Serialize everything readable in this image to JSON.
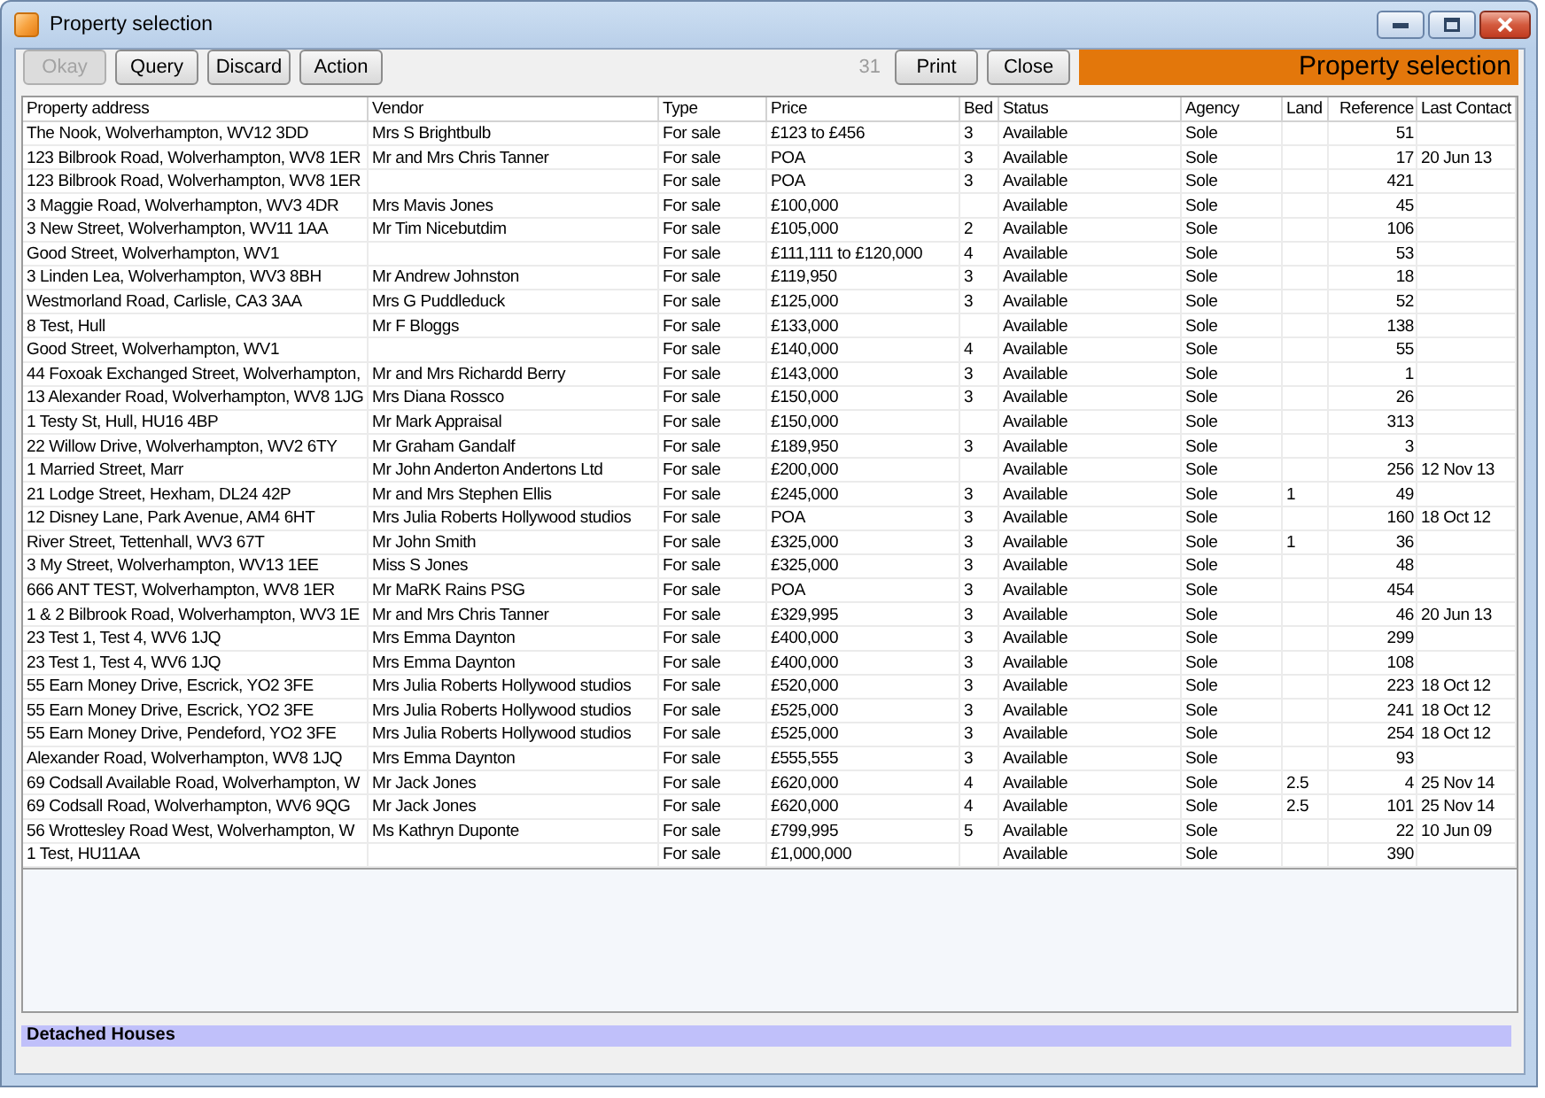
{
  "window": {
    "title": "Property selection"
  },
  "toolbar": {
    "buttons": [
      {
        "label": "Okay",
        "disabled": true
      },
      {
        "label": "Query",
        "disabled": false
      },
      {
        "label": "Discard",
        "disabled": false
      },
      {
        "label": "Action",
        "disabled": false
      }
    ],
    "record_count": "31",
    "right_buttons": [
      {
        "label": "Print",
        "disabled": false
      },
      {
        "label": "Close",
        "disabled": false
      }
    ],
    "banner": "Property selection"
  },
  "table": {
    "columns": [
      {
        "label": "Property address",
        "kind": "text"
      },
      {
        "label": "Vendor",
        "kind": "text"
      },
      {
        "label": "Type",
        "kind": "text"
      },
      {
        "label": "Price",
        "kind": "text"
      },
      {
        "label": "Bed",
        "kind": "text"
      },
      {
        "label": "Status",
        "kind": "text"
      },
      {
        "label": "Agency",
        "kind": "text"
      },
      {
        "label": "Land",
        "kind": "text"
      },
      {
        "label": "Reference",
        "kind": "number"
      },
      {
        "label": "Last Contact",
        "kind": "text"
      }
    ],
    "rows": [
      [
        "The Nook, Wolverhampton, WV12 3DD",
        "Mrs S Brightbulb",
        "For sale",
        "£123 to £456",
        "3",
        "Available",
        "Sole",
        null,
        "51",
        null
      ],
      [
        "123 Bilbrook Road, Wolverhampton, WV8 1ER",
        "Mr and Mrs Chris Tanner",
        "For sale",
        "POA",
        "3",
        "Available",
        "Sole",
        null,
        "17",
        "20 Jun 13"
      ],
      [
        "123 Bilbrook Road, Wolverhampton, WV8 1ER",
        null,
        "For sale",
        "POA",
        "3",
        "Available",
        "Sole",
        null,
        "421",
        null
      ],
      [
        "3 Maggie Road, Wolverhampton, WV3 4DR",
        "Mrs Mavis Jones",
        "For sale",
        "£100,000",
        null,
        "Available",
        "Sole",
        null,
        "45",
        null
      ],
      [
        "3 New Street, Wolverhampton, WV11 1AA",
        "Mr Tim Nicebutdim",
        "For sale",
        "£105,000",
        "2",
        "Available",
        "Sole",
        null,
        "106",
        null
      ],
      [
        "Good Street, Wolverhampton, WV1",
        null,
        "For sale",
        "£111,111 to £120,000",
        "4",
        "Available",
        "Sole",
        null,
        "53",
        null
      ],
      [
        "3 Linden Lea, Wolverhampton, WV3 8BH",
        "Mr Andrew Johnston",
        "For sale",
        "£119,950",
        "3",
        "Available",
        "Sole",
        null,
        "18",
        null
      ],
      [
        "Westmorland Road, Carlisle, CA3 3AA",
        "Mrs G Puddleduck",
        "For sale",
        "£125,000",
        "3",
        "Available",
        "Sole",
        null,
        "52",
        null
      ],
      [
        "8 Test, Hull",
        "Mr F Bloggs",
        "For sale",
        "£133,000",
        null,
        "Available",
        "Sole",
        null,
        "138",
        null
      ],
      [
        "Good Street, Wolverhampton, WV1",
        null,
        "For sale",
        "£140,000",
        "4",
        "Available",
        "Sole",
        null,
        "55",
        null
      ],
      [
        "44 Foxoak Exchanged Street, Wolverhampton,",
        "Mr and Mrs Richardd Berry",
        "For sale",
        "£143,000",
        "3",
        "Available",
        "Sole",
        null,
        "1",
        null
      ],
      [
        "13 Alexander Road, Wolverhampton, WV8 1JG",
        "Mrs Diana Rossco",
        "For sale",
        "£150,000",
        "3",
        "Available",
        "Sole",
        null,
        "26",
        null
      ],
      [
        "1 Testy St, Hull, HU16 4BP",
        "Mr Mark Appraisal",
        "For sale",
        "£150,000",
        null,
        "Available",
        "Sole",
        null,
        "313",
        null
      ],
      [
        "22 Willow Drive, Wolverhampton, WV2 6TY",
        "Mr Graham Gandalf",
        "For sale",
        "£189,950",
        "3",
        "Available",
        "Sole",
        null,
        "3",
        null
      ],
      [
        "1 Married Street, Marr",
        "Mr John Anderton Andertons Ltd",
        "For sale",
        "£200,000",
        null,
        "Available",
        "Sole",
        null,
        "256",
        "12 Nov 13"
      ],
      [
        "21 Lodge Street, Hexham, DL24 42P",
        "Mr and Mrs Stephen Ellis",
        "For sale",
        "£245,000",
        "3",
        "Available",
        "Sole",
        "1",
        "49",
        null
      ],
      [
        "12 Disney Lane, Park Avenue, AM4 6HT",
        "Mrs Julia Roberts Hollywood studios",
        "For sale",
        "POA",
        "3",
        "Available",
        "Sole",
        null,
        "160",
        "18 Oct 12"
      ],
      [
        "River Street, Tettenhall, WV3 67T",
        "Mr John Smith",
        "For sale",
        "£325,000",
        "3",
        "Available",
        "Sole",
        "1",
        "36",
        null
      ],
      [
        "3 My Street, Wolverhampton, WV13 1EE",
        "Miss S Jones",
        "For sale",
        "£325,000",
        "3",
        "Available",
        "Sole",
        null,
        "48",
        null
      ],
      [
        "666 ANT TEST, Wolverhampton, WV8 1ER",
        "Mr MaRK Rains PSG",
        "For sale",
        "POA",
        "3",
        "Available",
        "Sole",
        null,
        "454",
        null
      ],
      [
        "1 & 2 Bilbrook Road, Wolverhampton, WV3 1E",
        "Mr and Mrs Chris Tanner",
        "For sale",
        "£329,995",
        "3",
        "Available",
        "Sole",
        null,
        "46",
        "20 Jun 13"
      ],
      [
        "23 Test 1, Test 4, WV6 1JQ",
        "Mrs Emma Daynton",
        "For sale",
        "£400,000",
        "3",
        "Available",
        "Sole",
        null,
        "299",
        null
      ],
      [
        "23 Test 1, Test 4, WV6 1JQ",
        "Mrs Emma Daynton",
        "For sale",
        "£400,000",
        "3",
        "Available",
        "Sole",
        null,
        "108",
        null
      ],
      [
        "55 Earn Money Drive, Escrick, YO2 3FE",
        "Mrs Julia Roberts Hollywood studios",
        "For sale",
        "£520,000",
        "3",
        "Available",
        "Sole",
        null,
        "223",
        "18 Oct 12"
      ],
      [
        "55 Earn Money Drive, Escrick, YO2 3FE",
        "Mrs Julia Roberts Hollywood studios",
        "For sale",
        "£525,000",
        "3",
        "Available",
        "Sole",
        null,
        "241",
        "18 Oct 12"
      ],
      [
        "55 Earn Money Drive, Pendeford, YO2 3FE",
        "Mrs Julia Roberts Hollywood studios",
        "For sale",
        "£525,000",
        "3",
        "Available",
        "Sole",
        null,
        "254",
        "18 Oct 12"
      ],
      [
        "Alexander Road, Wolverhampton, WV8 1JQ",
        "Mrs Emma Daynton",
        "For sale",
        "£555,555",
        "3",
        "Available",
        "Sole",
        null,
        "93",
        null
      ],
      [
        "69 Codsall Available Road, Wolverhampton, W",
        "Mr Jack Jones",
        "For sale",
        "£620,000",
        "4",
        "Available",
        "Sole",
        "2.5",
        "4",
        "25 Nov 14"
      ],
      [
        "69 Codsall Road, Wolverhampton, WV6 9QG",
        "Mr Jack Jones",
        "For sale",
        "£620,000",
        "4",
        "Available",
        "Sole",
        "2.5",
        "101",
        "25 Nov 14"
      ],
      [
        "56 Wrottesley Road West, Wolverhampton, W",
        "Ms Kathryn Duponte",
        "For sale",
        "£799,995",
        "5",
        "Available",
        "Sole",
        null,
        "22",
        "10 Jun 09"
      ],
      [
        "1 Test, HU11AA",
        null,
        "For sale",
        "£1,000,000",
        null,
        "Available",
        "Sole",
        null,
        "390",
        null
      ]
    ]
  },
  "status_bar": {
    "text": "Detached Houses"
  }
}
